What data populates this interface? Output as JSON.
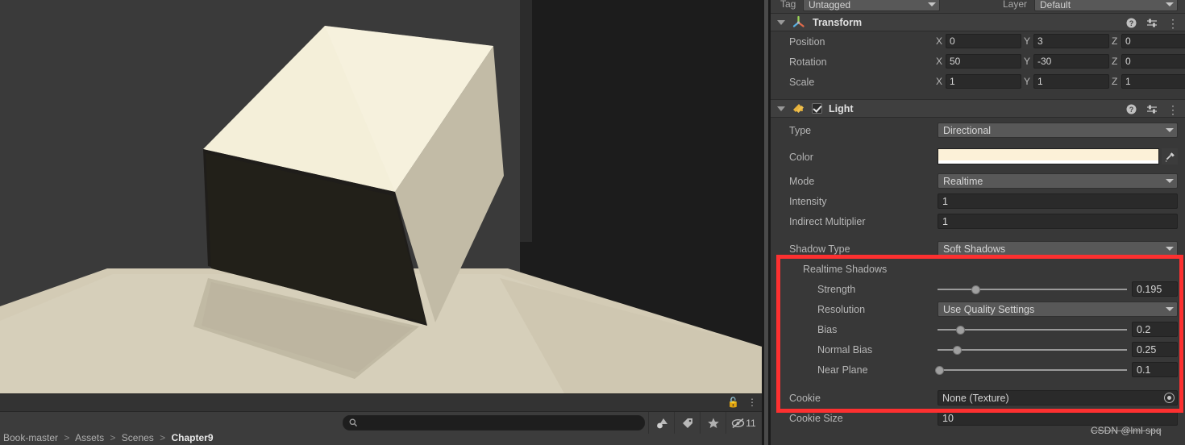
{
  "scene": {
    "footer": {
      "lock_icon": "lock-icon",
      "menu_icon": "kebab-menu-icon"
    },
    "search": {
      "value": "",
      "placeholder": "",
      "icon": "search-icon"
    },
    "toolbar_buttons": [
      {
        "name": "shapes-icon",
        "label": ""
      },
      {
        "name": "tag-icon",
        "label": ""
      },
      {
        "name": "star-icon",
        "label": ""
      },
      {
        "name": "hidden-objects-icon",
        "label": "11"
      }
    ],
    "breadcrumb": {
      "parts": [
        "Book-master",
        "Assets",
        "Scenes"
      ],
      "current": "Chapter9",
      "separator": ">"
    }
  },
  "inspector": {
    "tag_layer": {
      "tag_label": "Tag",
      "tag_value": "Untagged",
      "layer_label": "Layer",
      "layer_value": "Default"
    },
    "transform": {
      "title": "Transform",
      "icon": "transform-axes-icon",
      "help_icon": "help-icon",
      "preset_icon": "preset-settings-icon",
      "menu_icon": "kebab-menu-icon",
      "rows": [
        {
          "label": "Position",
          "x": "0",
          "y": "3",
          "z": "0"
        },
        {
          "label": "Rotation",
          "x": "50",
          "y": "-30",
          "z": "0"
        },
        {
          "label": "Scale",
          "x": "1",
          "y": "1",
          "z": "1"
        }
      ],
      "axis_labels": {
        "x": "X",
        "y": "Y",
        "z": "Z"
      }
    },
    "light": {
      "title": "Light",
      "icon": "light-bulb-rays-icon",
      "enabled": true,
      "help_icon": "help-icon",
      "preset_icon": "preset-settings-icon",
      "menu_icon": "kebab-menu-icon",
      "type": {
        "label": "Type",
        "value": "Directional"
      },
      "color": {
        "label": "Color",
        "value": "#FCF1D8",
        "alpha_bar": "#FFFFFF",
        "picker_icon": "eyedropper-icon"
      },
      "mode": {
        "label": "Mode",
        "value": "Realtime"
      },
      "intensity": {
        "label": "Intensity",
        "value": "1"
      },
      "indirect_multiplier": {
        "label": "Indirect Multiplier",
        "value": "1"
      },
      "shadow_type": {
        "label": "Shadow Type",
        "value": "Soft Shadows"
      },
      "realtime_shadows_label": "Realtime Shadows",
      "strength": {
        "label": "Strength",
        "value": "0.195",
        "fill": 20
      },
      "resolution": {
        "label": "Resolution",
        "value": "Use Quality Settings"
      },
      "bias": {
        "label": "Bias",
        "value": "0.2",
        "fill": 12
      },
      "normal_bias": {
        "label": "Normal Bias",
        "value": "0.25",
        "fill": 10
      },
      "near_plane": {
        "label": "Near Plane",
        "value": "0.1",
        "fill": 1
      },
      "cookie": {
        "label": "Cookie",
        "value": "None (Texture)",
        "picker_icon": "object-picker-icon"
      },
      "cookie_size": {
        "label": "Cookie Size",
        "value": "10"
      }
    },
    "annotation": {
      "color": "#FD3030",
      "name": "realtime-shadows-highlight"
    }
  },
  "watermark": {
    "text": "CSDN @lml spq"
  }
}
